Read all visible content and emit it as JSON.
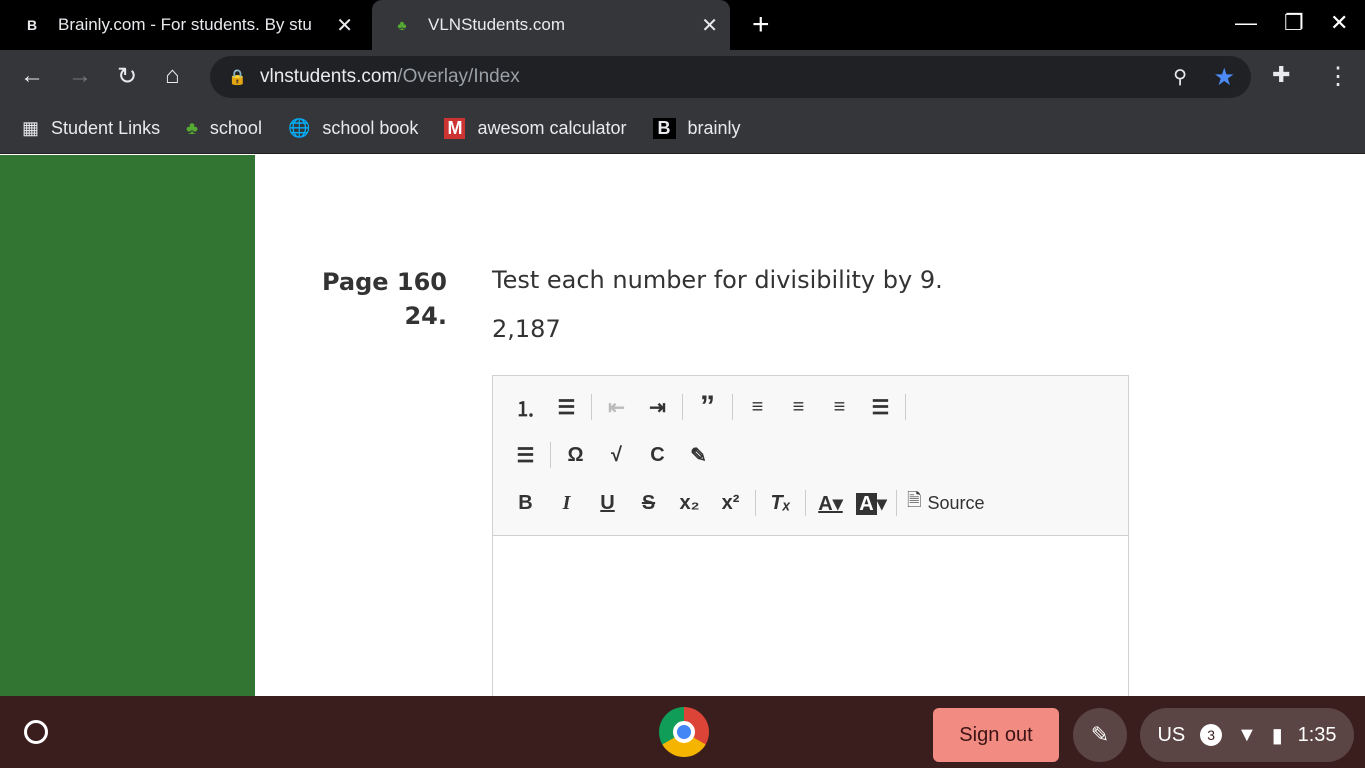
{
  "tabs": [
    {
      "label": "Brainly.com - For students. By stu",
      "favicon": "B"
    },
    {
      "label": "VLNStudents.com"
    }
  ],
  "address": {
    "domain": "vlnstudents.com",
    "path": "/Overlay/Index"
  },
  "bookmarks": [
    {
      "label": "Student Links"
    },
    {
      "label": "school"
    },
    {
      "label": "school book"
    },
    {
      "label": "awesom calculator"
    },
    {
      "label": "brainly"
    }
  ],
  "question": {
    "page": "Page 160",
    "number": "24.",
    "prompt": "Test each number for divisibility by 9.",
    "value": "2,187"
  },
  "editor": {
    "source_label": "Source"
  },
  "taskbar": {
    "sign_out": "Sign out",
    "locale": "US",
    "notifications": "3",
    "time": "1:35"
  }
}
